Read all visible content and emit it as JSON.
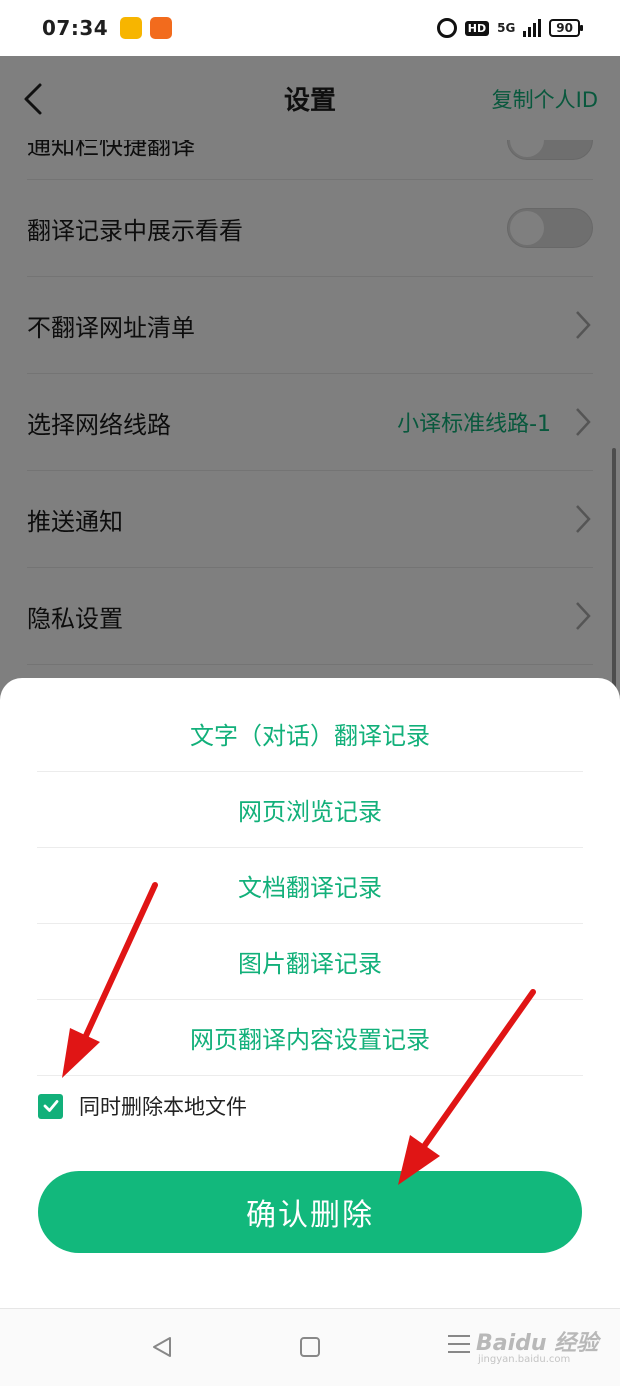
{
  "status_bar": {
    "time": "07:34",
    "network": "5G",
    "hd": "HD",
    "battery": "90"
  },
  "header": {
    "title": "设置",
    "copy_id": "复制个人ID"
  },
  "settings": {
    "rows": [
      {
        "label": "通知栏快捷翻译",
        "control": "toggle",
        "on": false
      },
      {
        "label": "翻译记录中展示看看",
        "control": "toggle",
        "on": false
      },
      {
        "label": "不翻译网址清单",
        "control": "chevron"
      },
      {
        "label": "选择网络线路",
        "value": "小译标准线路-1",
        "control": "chevron"
      },
      {
        "label": "推送通知",
        "control": "chevron"
      },
      {
        "label": "隐私设置",
        "control": "chevron"
      }
    ]
  },
  "delete_sheet": {
    "options": [
      "文字（对话）翻译记录",
      "网页浏览记录",
      "文档翻译记录",
      "图片翻译记录",
      "网页翻译内容设置记录"
    ],
    "checkbox_label": "同时删除本地文件",
    "checkbox_checked": true,
    "confirm_label": "确认删除"
  },
  "watermark": {
    "brand": "Baidu 经验",
    "url": "jingyan.baidu.com"
  },
  "colors": {
    "accent": "#12b07a",
    "confirm_button": "#12b87c",
    "annotation_arrow": "#e01515"
  },
  "icons": [
    "back-icon",
    "chevron-right-icon",
    "check-icon",
    "alarm-icon",
    "signal-icon",
    "battery-icon"
  ]
}
